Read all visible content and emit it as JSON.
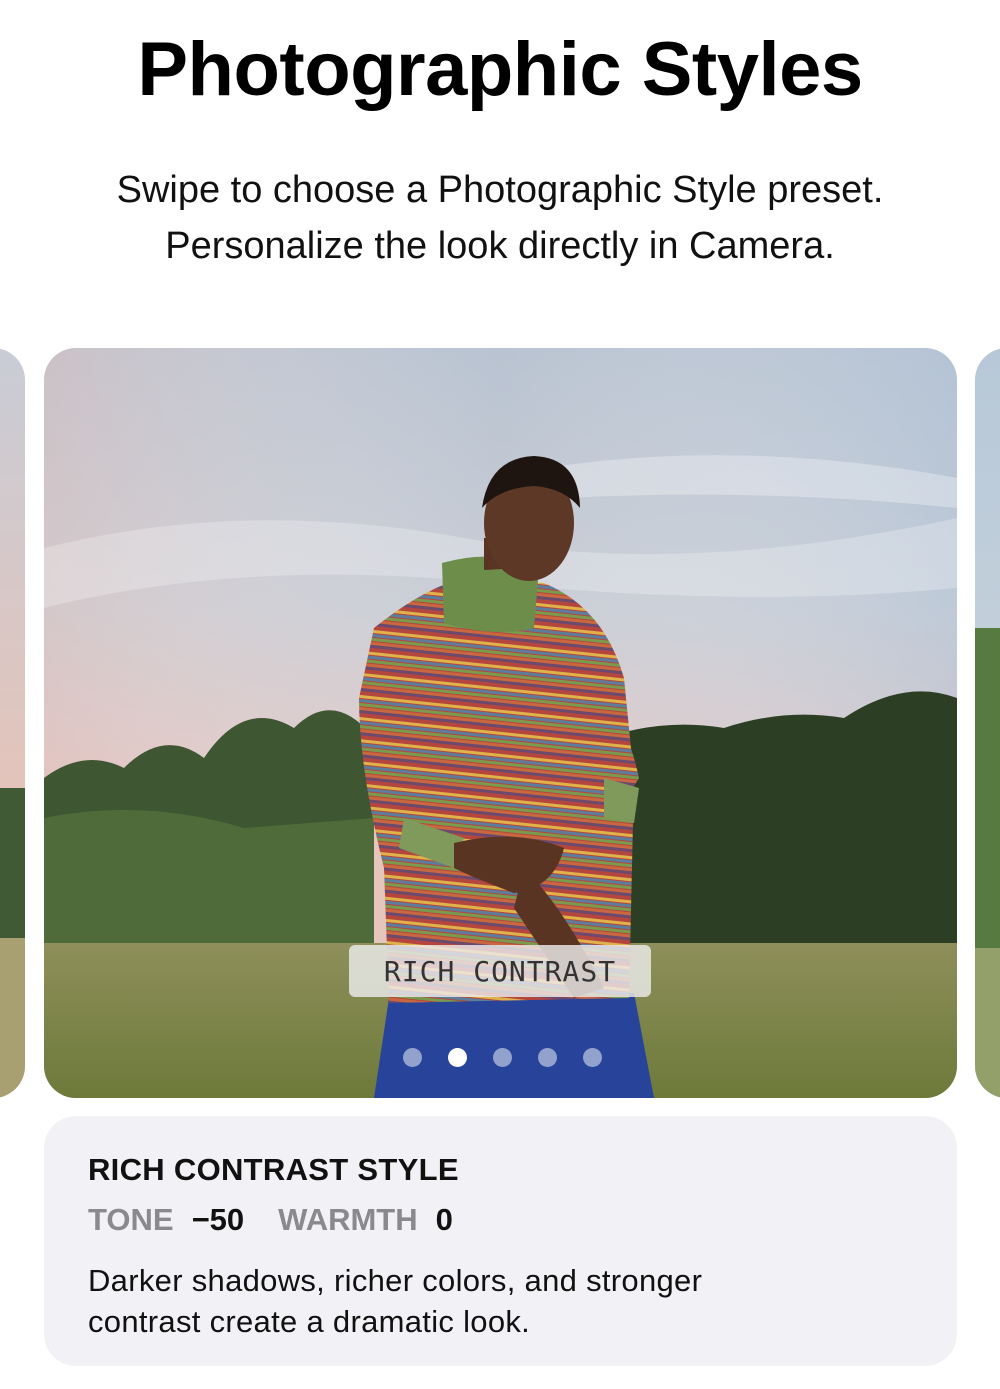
{
  "header": {
    "title": "Photographic Styles",
    "subtitle_line1": "Swipe to choose a Photographic Style preset.",
    "subtitle_line2": "Personalize the look directly in Camera."
  },
  "carousel": {
    "current_style_label": "RICH CONTRAST",
    "page_count": 5,
    "active_page": 2
  },
  "info": {
    "style_name": "RICH CONTRAST STYLE",
    "tone_label": "TONE",
    "tone_value": "−50",
    "warmth_label": "WARMTH",
    "warmth_value": "0",
    "description_line1": "Darker shadows, richer colors, and stronger",
    "description_line2": "contrast create a dramatic look."
  },
  "colors": {
    "card_background": "#f2f2f6",
    "muted_label": "#8a8a8e"
  }
}
